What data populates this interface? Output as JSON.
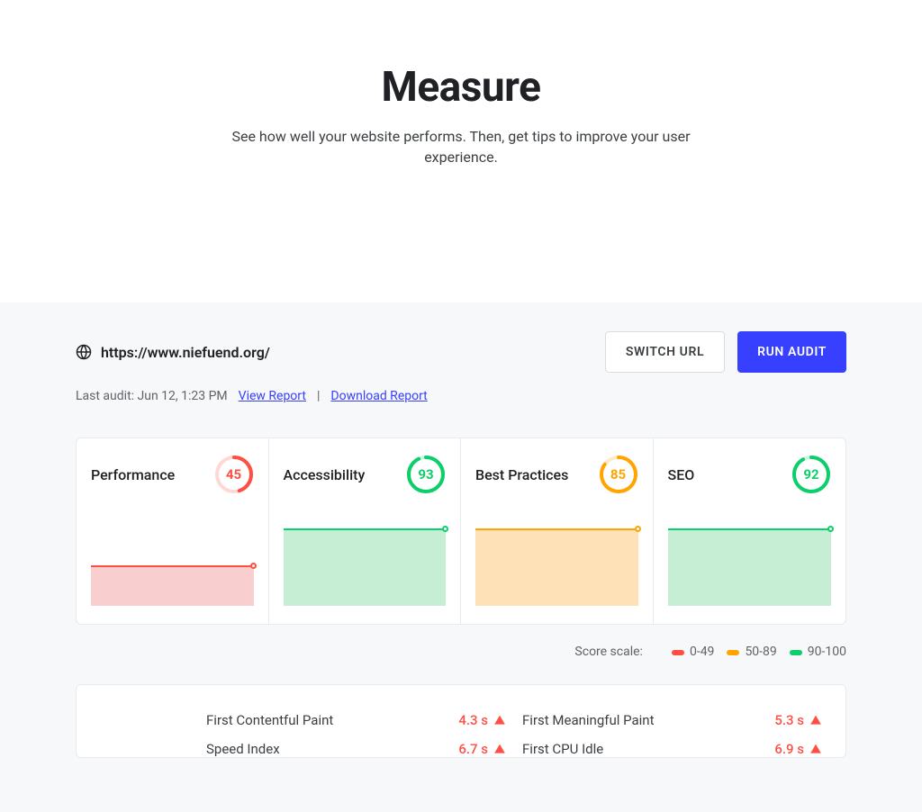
{
  "hero": {
    "title": "Measure",
    "subtitle": "See how well your website performs. Then, get tips to improve your user experience."
  },
  "url": "https://www.niefuend.org/",
  "last_audit_label": "Last audit: Jun 12, 1:23 PM",
  "links": {
    "view_report": "View Report",
    "download_report": "Download Report"
  },
  "buttons": {
    "switch_url": "SWITCH URL",
    "run_audit": "RUN AUDIT"
  },
  "colors": {
    "fail": "#ff4e42",
    "fail_bg": "#f8cfce",
    "avg": "#ffa400",
    "avg_bg": "#ffe1b8",
    "pass": "#0cce6b",
    "pass_bg": "#c5eed4",
    "primary": "#3740ff"
  },
  "cards": [
    {
      "label": "Performance",
      "score": 45,
      "status": "fail"
    },
    {
      "label": "Accessibility",
      "score": 93,
      "status": "pass"
    },
    {
      "label": "Best Practices",
      "score": 85,
      "status": "avg"
    },
    {
      "label": "SEO",
      "score": 92,
      "status": "pass"
    }
  ],
  "legend": {
    "title": "Score scale:",
    "items": [
      {
        "label": "0-49",
        "color_key": "fail"
      },
      {
        "label": "50-89",
        "color_key": "avg"
      },
      {
        "label": "90-100",
        "color_key": "pass"
      }
    ]
  },
  "metrics": [
    {
      "name": "First Contentful Paint",
      "value": "4.3 s",
      "status": "fail"
    },
    {
      "name": "First Meaningful Paint",
      "value": "5.3 s",
      "status": "fail"
    },
    {
      "name": "Speed Index",
      "value": "6.7 s",
      "status": "fail"
    },
    {
      "name": "First CPU Idle",
      "value": "6.9 s",
      "status": "fail"
    }
  ]
}
